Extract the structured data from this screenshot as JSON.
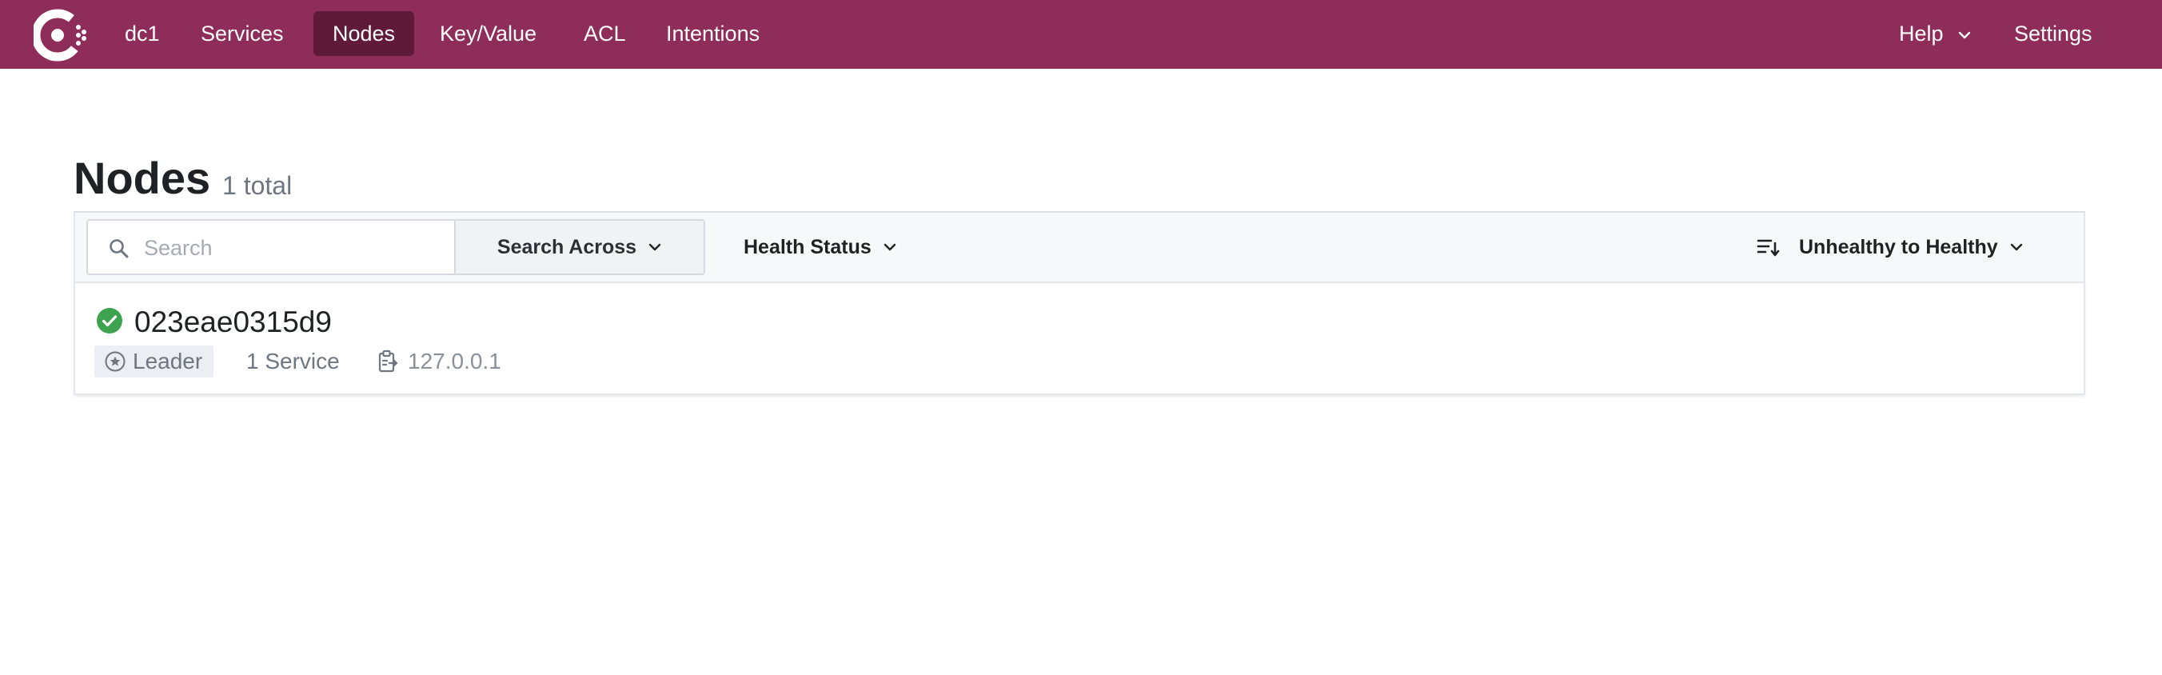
{
  "nav": {
    "datacenter": "dc1",
    "items": [
      {
        "label": "Services"
      },
      {
        "label": "Nodes"
      },
      {
        "label": "Key/Value"
      },
      {
        "label": "ACL"
      },
      {
        "label": "Intentions"
      }
    ],
    "active": "Nodes",
    "help_label": "Help",
    "settings_label": "Settings"
  },
  "page": {
    "title": "Nodes",
    "count": "1 total"
  },
  "filters": {
    "search_placeholder": "Search",
    "search_value": "",
    "search_across_label": "Search Across",
    "health_status_label": "Health Status",
    "sort_label": "Unhealthy to Healthy"
  },
  "nodes": [
    {
      "name": "023eae0315d9",
      "status": "passing",
      "status_color": "#3ea34f",
      "badge": "Leader",
      "services": "1 Service",
      "address": "127.0.0.1"
    }
  ],
  "colors": {
    "brand": "#8e2c5a",
    "active_nav": "#5f1a3a"
  },
  "icons": {
    "logo": "consul-logo",
    "search": "search-icon",
    "status": "check-circle-icon",
    "leader": "star-circle-icon",
    "address": "clipboard-icon",
    "sort": "sort-icon",
    "chevron": "chevron-down-icon"
  }
}
